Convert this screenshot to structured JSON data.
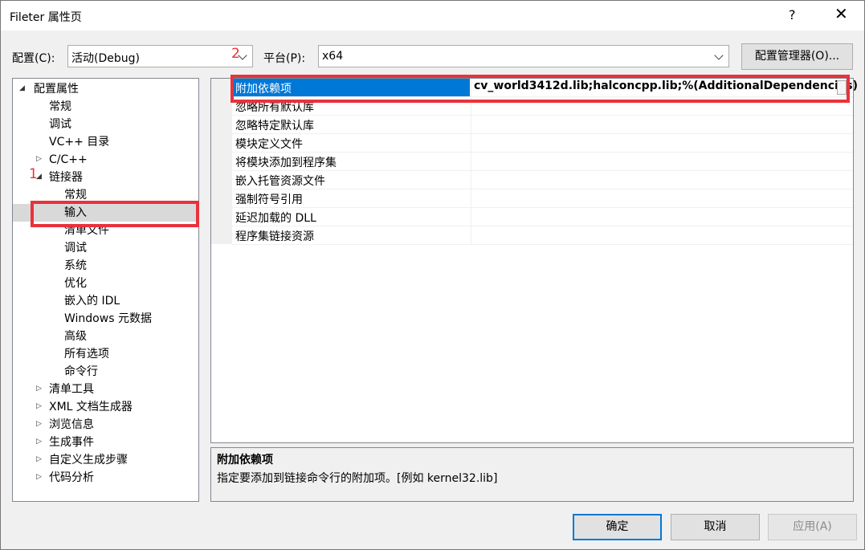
{
  "window": {
    "title": "Fileter 属性页",
    "help_label": "?",
    "close_label": "✕"
  },
  "config": {
    "label": "配置(C):",
    "value": "活动(Debug)"
  },
  "platform": {
    "label": "平台(P):",
    "value": "x64"
  },
  "config_manager_label": "配置管理器(O)...",
  "tree": [
    {
      "label": "配置属性",
      "expander": "◢"
    },
    {
      "label": "常规"
    },
    {
      "label": "调试"
    },
    {
      "label": "VC++ 目录"
    },
    {
      "label": "C/C++",
      "expander": "▷"
    },
    {
      "label": "链接器",
      "expander": "◢"
    },
    {
      "label": "常规"
    },
    {
      "label": "输入"
    },
    {
      "label": "清单文件"
    },
    {
      "label": "调试"
    },
    {
      "label": "系统"
    },
    {
      "label": "优化"
    },
    {
      "label": "嵌入的 IDL"
    },
    {
      "label": "Windows 元数据"
    },
    {
      "label": "高级"
    },
    {
      "label": "所有选项"
    },
    {
      "label": "命令行"
    },
    {
      "label": "清单工具",
      "expander": "▷"
    },
    {
      "label": "XML 文档生成器",
      "expander": "▷"
    },
    {
      "label": "浏览信息",
      "expander": "▷"
    },
    {
      "label": "生成事件",
      "expander": "▷"
    },
    {
      "label": "自定义生成步骤",
      "expander": "▷"
    },
    {
      "label": "代码分析",
      "expander": "▷"
    }
  ],
  "properties": [
    {
      "name": "附加依赖项",
      "value": "cv_world3412d.lib;halconcpp.lib;%(AdditionalDependencies)"
    },
    {
      "name": "忽略所有默认库",
      "value": ""
    },
    {
      "name": "忽略特定默认库",
      "value": ""
    },
    {
      "name": "模块定义文件",
      "value": ""
    },
    {
      "name": "将模块添加到程序集",
      "value": ""
    },
    {
      "name": "嵌入托管资源文件",
      "value": ""
    },
    {
      "name": "强制符号引用",
      "value": ""
    },
    {
      "name": "延迟加载的 DLL",
      "value": ""
    },
    {
      "name": "程序集链接资源",
      "value": ""
    }
  ],
  "description": {
    "title": "附加依赖项",
    "text": "指定要添加到链接命令行的附加项。[例如 kernel32.lib]"
  },
  "buttons": {
    "ok": "确定",
    "cancel": "取消",
    "apply": "应用(A)"
  },
  "annotations": {
    "one": "1",
    "two": "2"
  },
  "colors": {
    "accent": "#0078d7",
    "highlight": "#e8323c"
  }
}
